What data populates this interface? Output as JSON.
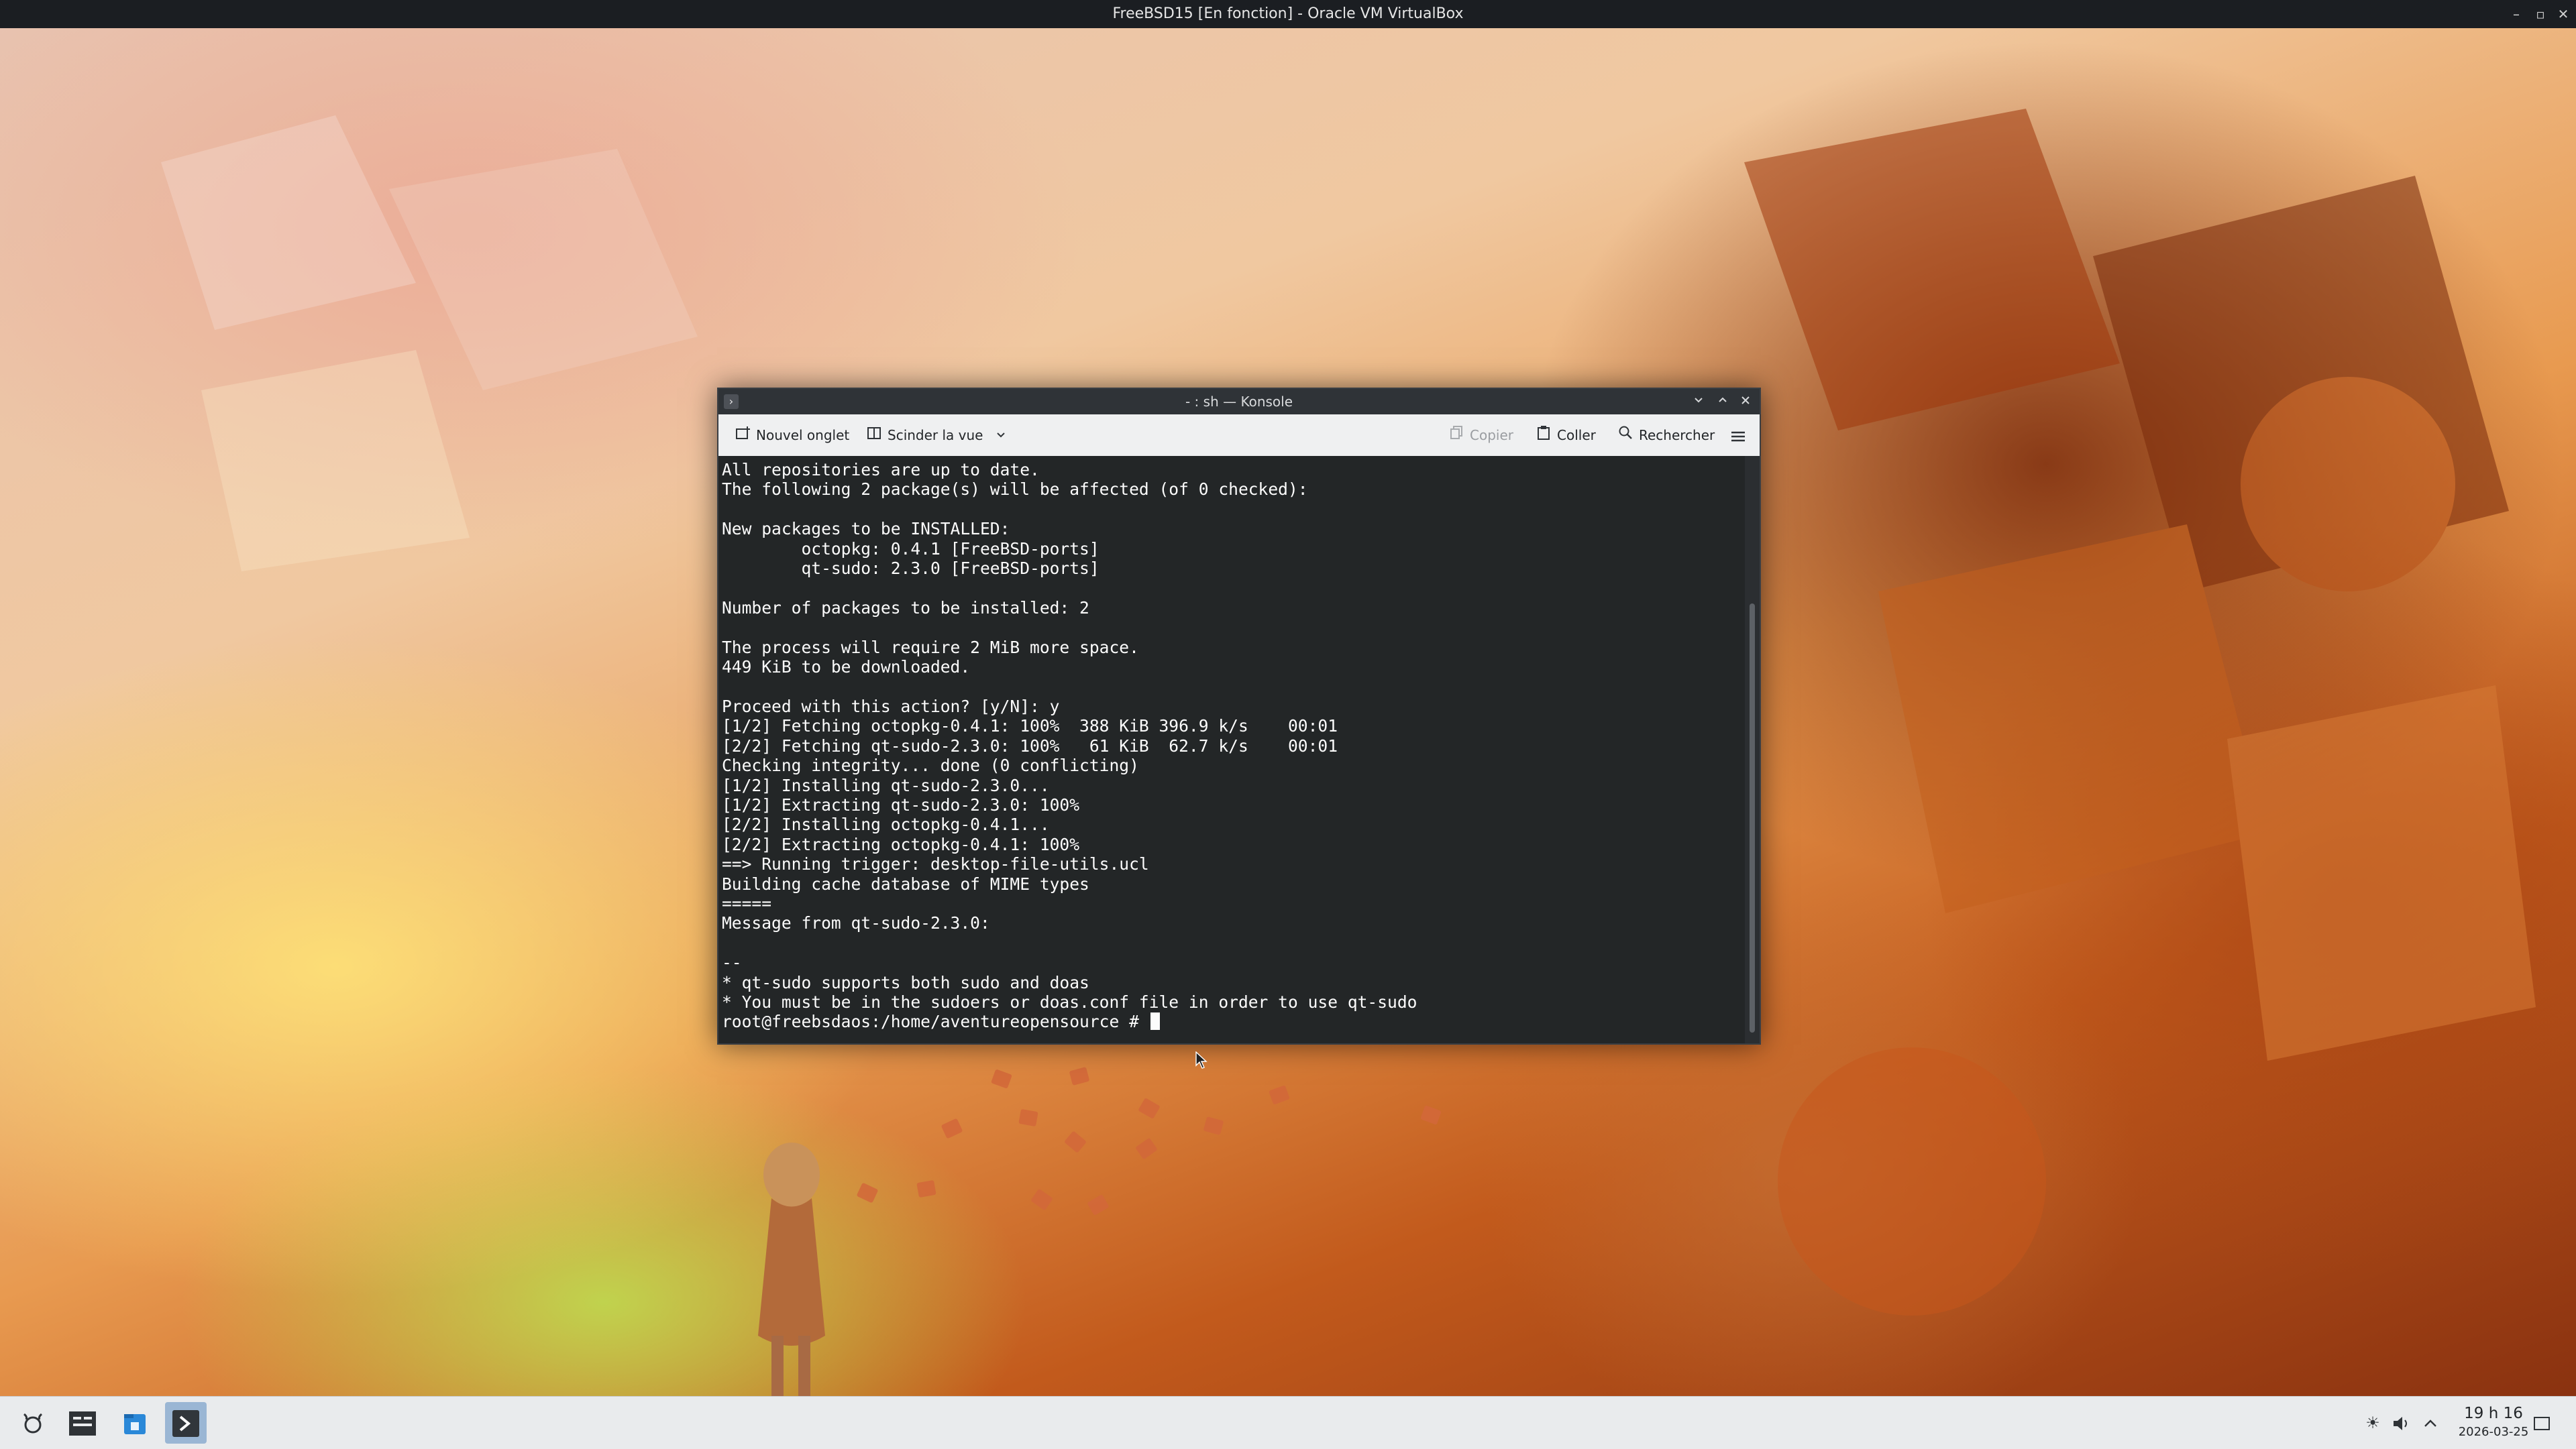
{
  "host_window": {
    "title": "FreeBSD15 [En fonction] - Oracle VM VirtualBox",
    "controls": {
      "minimize": "–",
      "restore": "▫",
      "close": "✕"
    }
  },
  "konsole": {
    "title": "- : sh — Konsole",
    "toolbar": {
      "new_tab": "Nouvel onglet",
      "split_view": "Scinder la vue",
      "copy": "Copier",
      "paste": "Coller",
      "search": "Rechercher"
    },
    "terminal_lines": [
      "All repositories are up to date.",
      "The following 2 package(s) will be affected (of 0 checked):",
      "",
      "New packages to be INSTALLED:",
      "        octopkg: 0.4.1 [FreeBSD-ports]",
      "        qt-sudo: 2.3.0 [FreeBSD-ports]",
      "",
      "Number of packages to be installed: 2",
      "",
      "The process will require 2 MiB more space.",
      "449 KiB to be downloaded.",
      "",
      "Proceed with this action? [y/N]: y",
      "[1/2] Fetching octopkg-0.4.1: 100%  388 KiB 396.9 k/s    00:01",
      "[2/2] Fetching qt-sudo-2.3.0: 100%   61 KiB  62.7 k/s    00:01",
      "Checking integrity... done (0 conflicting)",
      "[1/2] Installing qt-sudo-2.3.0...",
      "[1/2] Extracting qt-sudo-2.3.0: 100%",
      "[2/2] Installing octopkg-0.4.1...",
      "[2/2] Extracting octopkg-0.4.1: 100%",
      "==> Running trigger: desktop-file-utils.ucl",
      "Building cache database of MIME types",
      "=====",
      "Message from qt-sudo-2.3.0:",
      "",
      "--",
      "* qt-sudo supports both sudo and doas",
      "* You must be in the sudoers or doas.conf file in order to use qt-sudo"
    ],
    "prompt": "root@freebsdaos:/home/aventureopensource # "
  },
  "taskbar": {
    "clock_time": "19 h 16",
    "clock_date": "2026-03-25"
  },
  "colors": {
    "terminal_bg": "#232627",
    "terminal_fg": "#fcfcfc",
    "toolbar_bg": "#eff0f1",
    "taskbar_bg": "#e9ebed",
    "active_task": "#9ab6d4"
  }
}
